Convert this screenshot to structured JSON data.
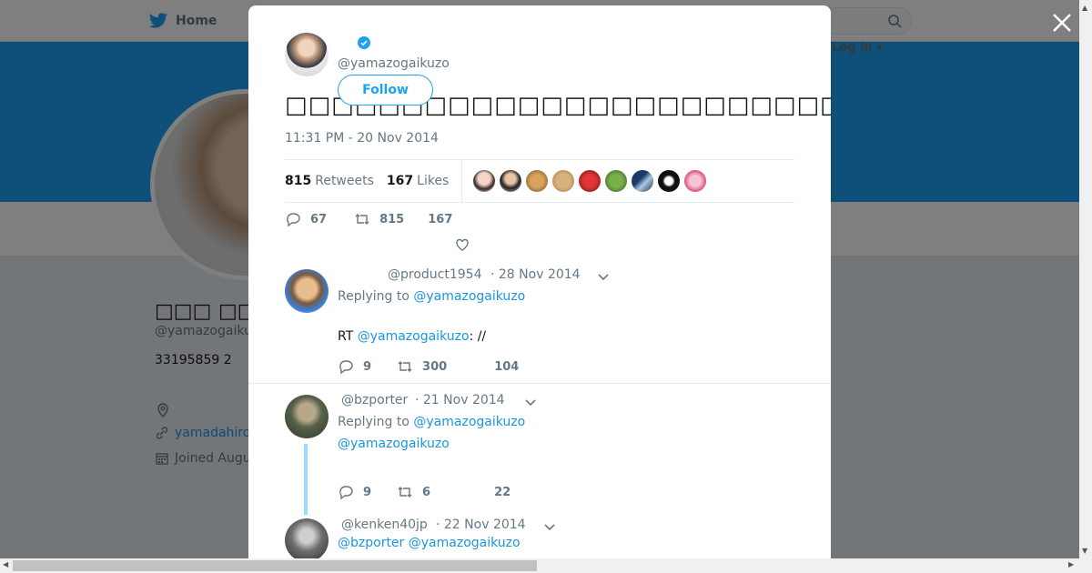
{
  "nav": {
    "home_label": "Home",
    "login_label": "Log in ▾"
  },
  "profile": {
    "name": "□□□ □□□□□",
    "handle": "@yamazogaiku",
    "bio": "33195859 2",
    "link": "yamadahiro",
    "joined": "Joined Augu"
  },
  "tweet": {
    "handle": "@yamazogaikuzo",
    "follow_label": "Follow",
    "text": "□□□□□□□□□□□□□□□□□□□□□□□□□□□□□□□□□□□□□□□□□□□□□□□□□□□□□□□□□□□□□□□□□□□",
    "time": "11:31 PM - 20 Nov 2014",
    "retweets_count": "815",
    "retweets_label": "Retweets",
    "likes_count": "167",
    "likes_label": "Likes",
    "actions": {
      "replies": "67",
      "retweets": "815",
      "likes": "167"
    }
  },
  "replies": [
    {
      "handle": "@product1954",
      "date": "· 28 Nov 2014",
      "replying_prefix": "Replying to",
      "replying_to": "@yamazogaikuzo",
      "body_prefix": "RT",
      "body_mention": "@yamazogaikuzo",
      "body_suffix": ": //",
      "actions": {
        "replies": "9",
        "retweets": "300",
        "likes": "104"
      }
    },
    {
      "handle": "@bzporter",
      "date": "· 21 Nov 2014",
      "replying_prefix": "Replying to",
      "replying_to": "@yamazogaikuzo",
      "body_mention": "@yamazogaikuzo",
      "actions": {
        "replies": "9",
        "retweets": "6",
        "likes": "22"
      }
    },
    {
      "handle": "@kenken40jp",
      "date": "· 22 Nov 2014",
      "mention1": "@bzporter",
      "mention2": "@yamazogaikuzo"
    }
  ],
  "colors": {
    "accent": "#1da1f2",
    "link": "#1b95e0",
    "muted": "#657786"
  }
}
